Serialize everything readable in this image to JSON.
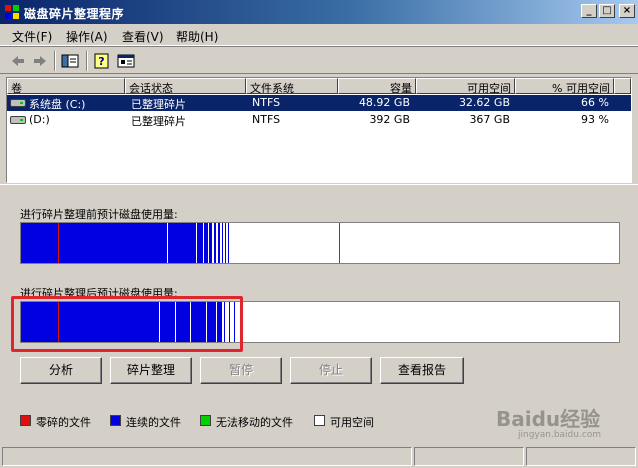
{
  "window": {
    "title": "磁盘碎片整理程序"
  },
  "titlebar_buttons": {
    "minimize": "_",
    "maximize": "□",
    "close": "×"
  },
  "menu": {
    "items": [
      {
        "label": "文件(F)"
      },
      {
        "label": "操作(A)"
      },
      {
        "label": "查看(V)"
      },
      {
        "label": "帮助(H)"
      }
    ]
  },
  "toolbar": {
    "icons": [
      "back-arrow-icon",
      "forward-arrow-icon",
      "show-hide-tree-icon",
      "help-icon",
      "properties-icon"
    ]
  },
  "volumes": {
    "columns": [
      "卷",
      "会话状态",
      "文件系统",
      "容量",
      "可用空间",
      "% 可用空间"
    ],
    "rows": [
      {
        "volume": "系统盘 (C:)",
        "status": "已整理碎片",
        "fs": "NTFS",
        "capacity": "48.92 GB",
        "free": "32.62 GB",
        "pct": "66 %",
        "selected": true
      },
      {
        "volume": "(D:)",
        "status": "已整理碎片",
        "fs": "NTFS",
        "capacity": "392 GB",
        "free": "367 GB",
        "pct": "93 %",
        "selected": false
      }
    ]
  },
  "analysis": {
    "before_label": "进行碎片整理前预计磁盘使用量:",
    "after_label": "进行碎片整理后预计磁盘使用量:"
  },
  "buttons": {
    "analyze": "分析",
    "defrag": "碎片整理",
    "pause": "暂停",
    "stop": "停止",
    "report": "查看报告"
  },
  "legend": [
    {
      "label": "零碎的文件",
      "color": "#e01010"
    },
    {
      "label": "连续的文件",
      "color": "#0000e0"
    },
    {
      "label": "无法移动的文件",
      "color": "#00d000"
    },
    {
      "label": "可用空间",
      "color": "#ffffff"
    }
  ],
  "colors": {
    "fragmented": "#e01010",
    "contiguous": "#0000e0",
    "unmovable": "#00d000",
    "free": "#ffffff",
    "selection": "#0a246a",
    "highlight": "#e0262d"
  },
  "watermark": {
    "text": "Baidu经验",
    "sub": "jingyan.baidu.com"
  }
}
